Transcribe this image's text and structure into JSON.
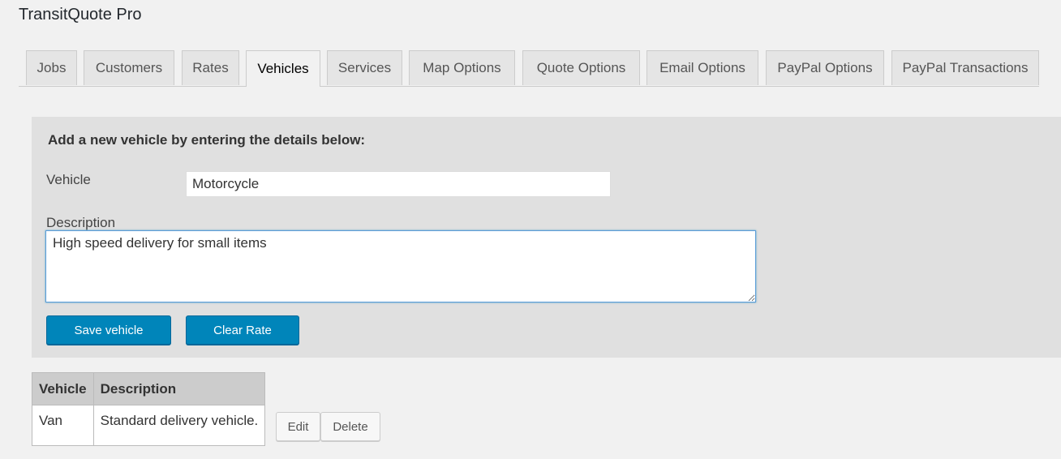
{
  "app": {
    "title": "TransitQuote Pro"
  },
  "tabs": [
    {
      "label": "Jobs",
      "active": false
    },
    {
      "label": "Customers",
      "active": false
    },
    {
      "label": "Rates",
      "active": false
    },
    {
      "label": "Vehicles",
      "active": true
    },
    {
      "label": "Services",
      "active": false
    },
    {
      "label": "Map Options",
      "active": false
    },
    {
      "label": "Quote Options",
      "active": false
    },
    {
      "label": "Email Options",
      "active": false
    },
    {
      "label": "PayPal Options",
      "active": false
    },
    {
      "label": "PayPal Transactions",
      "active": false
    }
  ],
  "form": {
    "heading": "Add a new vehicle by entering the details below:",
    "vehicle_label": "Vehicle",
    "vehicle_value": "Motorcycle",
    "description_label": "Description",
    "description_value": "High speed delivery for small items",
    "save_label": "Save vehicle",
    "clear_label": "Clear Rate"
  },
  "table": {
    "columns": [
      "Vehicle",
      "Description"
    ],
    "rows": [
      {
        "vehicle": "Van",
        "description": "Standard delivery vehicle.",
        "edit_label": "Edit",
        "delete_label": "Delete"
      }
    ]
  },
  "colors": {
    "primary_button": "#0085ba",
    "focus_border": "#5b9dd9",
    "panel_bg": "#e0e0e0",
    "page_bg": "#f1f1f1"
  }
}
